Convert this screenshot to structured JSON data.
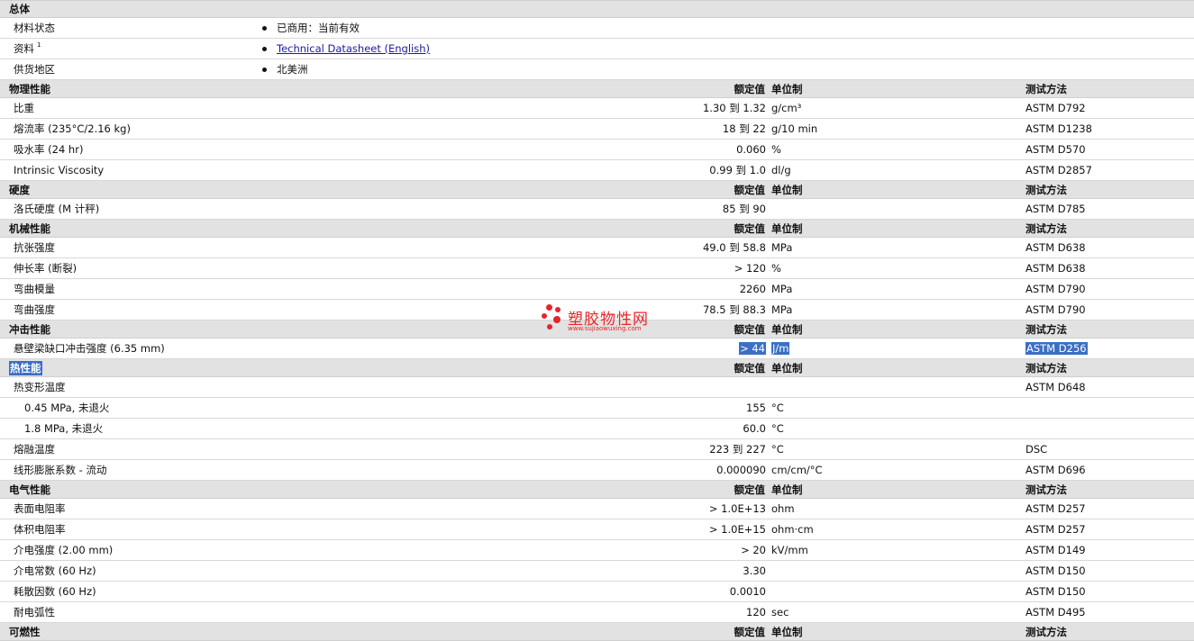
{
  "headers": {
    "value": "额定值",
    "unit": "单位制",
    "test": "测试方法"
  },
  "general": {
    "title": "总体",
    "rows": [
      {
        "label": "材料状态",
        "text": "已商用：当前有效",
        "sup": "",
        "is_link": false
      },
      {
        "label": "资料",
        "text": "Technical Datasheet (English)",
        "sup": "1",
        "is_link": true
      },
      {
        "label": "供货地区",
        "text": "北美洲",
        "sup": "",
        "is_link": false
      }
    ]
  },
  "sections": [
    {
      "title": "物理性能",
      "rows": [
        {
          "name": "比重",
          "value": "1.30 到  1.32",
          "unit": "g/cm³",
          "test": "ASTM D792"
        },
        {
          "name": "熔流率  (235°C/2.16 kg)",
          "value": "18 到  22",
          "unit": "g/10 min",
          "test": "ASTM D1238"
        },
        {
          "name": "吸水率  (24 hr)",
          "value": "0.060",
          "unit": "%",
          "test": "ASTM D570"
        },
        {
          "name": "Intrinsic Viscosity",
          "value": "0.99 到  1.0",
          "unit": "dl/g",
          "test": "ASTM D2857"
        }
      ]
    },
    {
      "title": "硬度",
      "rows": [
        {
          "name": "洛氏硬度  (M 计秤)",
          "value": "85 到  90",
          "unit": "",
          "test": "ASTM D785"
        }
      ]
    },
    {
      "title": "机械性能",
      "rows": [
        {
          "name": "抗张强度",
          "value": "49.0 到  58.8",
          "unit": "MPa",
          "test": "ASTM D638"
        },
        {
          "name": "伸长率  (断裂)",
          "value": "> 120",
          "unit": "%",
          "test": "ASTM D638"
        },
        {
          "name": "弯曲模量",
          "value": "2260",
          "unit": "MPa",
          "test": "ASTM D790"
        },
        {
          "name": "弯曲强度",
          "value": "78.5 到  88.3",
          "unit": "MPa",
          "test": "ASTM D790"
        }
      ]
    },
    {
      "title": "冲击性能",
      "rows": [
        {
          "name": "悬壁梁缺口冲击强度  (6.35 mm)",
          "value": "> 44",
          "unit": "J/m",
          "test": "ASTM D256",
          "highlight": true
        }
      ]
    },
    {
      "title": "热性能",
      "title_highlight": true,
      "rows": [
        {
          "name": "热变形温度",
          "value": "",
          "unit": "",
          "test": "ASTM D648"
        },
        {
          "name": "0.45 MPa, 未退火",
          "value": "155",
          "unit": "°C",
          "test": "",
          "sub": true
        },
        {
          "name": "1.8 MPa, 未退火",
          "value": "60.0",
          "unit": "°C",
          "test": "",
          "sub": true
        },
        {
          "name": "熔融温度",
          "value": "223 到  227",
          "unit": "°C",
          "test": "DSC"
        },
        {
          "name": "线形膨胀系数  - 流动",
          "value": "0.000090",
          "unit": "cm/cm/°C",
          "test": "ASTM D696"
        }
      ]
    },
    {
      "title": "电气性能",
      "rows": [
        {
          "name": "表面电阻率",
          "value": "> 1.0E+13",
          "unit": "ohm",
          "test": "ASTM D257"
        },
        {
          "name": "体积电阻率",
          "value": "> 1.0E+15",
          "unit": "ohm·cm",
          "test": "ASTM D257"
        },
        {
          "name": "介电强度  (2.00 mm)",
          "value": "> 20",
          "unit": "kV/mm",
          "test": "ASTM D149"
        },
        {
          "name": "介电常数  (60 Hz)",
          "value": "3.30",
          "unit": "",
          "test": "ASTM D150"
        },
        {
          "name": "耗散因数  (60 Hz)",
          "value": "0.0010",
          "unit": "",
          "test": "ASTM D150"
        },
        {
          "name": "耐电弧性",
          "value": "120",
          "unit": "sec",
          "test": "ASTM D495"
        }
      ]
    },
    {
      "title": "可燃性",
      "rows": []
    }
  ],
  "watermark": {
    "name": "塑胶物性网",
    "url": "www.sujiaowuxing.com",
    "color": "#e8242a"
  },
  "colors": {
    "section_bg": "#e2e2e2",
    "selection": "#3a6fc4",
    "link": "#1a1aa6"
  }
}
